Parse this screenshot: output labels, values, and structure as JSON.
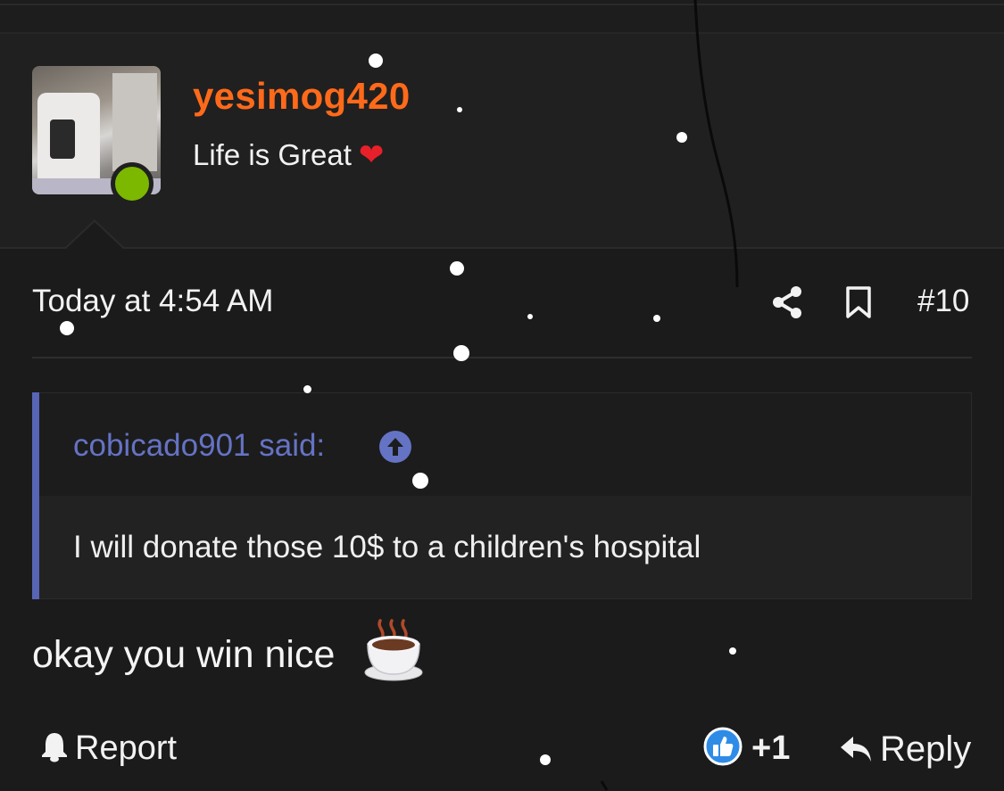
{
  "user": {
    "username": "yesimog420",
    "title": "Life is Great",
    "title_emoji": "❤️",
    "status": "online"
  },
  "post": {
    "date": "Today at 4:54 AM",
    "number": "#10",
    "message": "okay you win nice",
    "message_emoji": "☕"
  },
  "quote": {
    "author_label": "cobicado901 said:",
    "text": "I will donate those 10$ to a children's hospital"
  },
  "actions": {
    "report_label": "Report",
    "like_count": "+1",
    "reply_label": "Reply"
  },
  "icons": {
    "share": "share-icon",
    "bookmark": "bookmark-icon",
    "quote_jump": "arrow-up-circle-icon",
    "report": "bell-icon",
    "like": "thumbs-up-icon",
    "reply": "reply-arrow-icon",
    "online": "online-status-icon"
  },
  "colors": {
    "background": "#1b1b1b",
    "username": "#ff6a1a",
    "quote_accent": "#5765b4",
    "online": "#7cb800",
    "like": "#2f8ce6"
  }
}
